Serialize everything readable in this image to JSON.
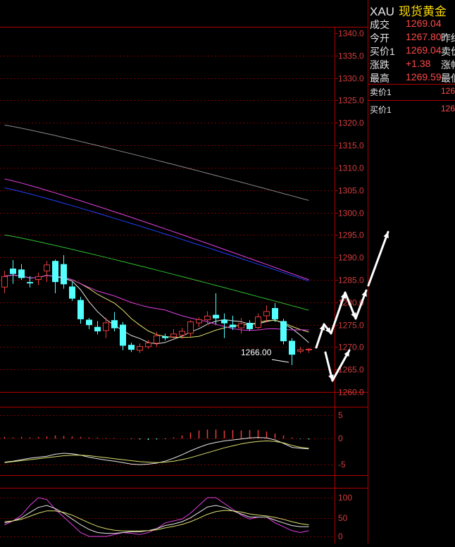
{
  "colors": {
    "background": "#000000",
    "frame": "#b00000",
    "grid": "#7a0000",
    "axis_text": "#d23c3c",
    "up_candle": "#e63c3c",
    "down_candle": "#54ffff",
    "ma_gray": "#8a8a8a",
    "ma_magenta": "#e040e0",
    "ma_blue": "#2040ff",
    "ma_green": "#30c030",
    "ma_yellow": "#e0e070",
    "ma_white": "#e6e6e6",
    "annotation_arrow": "#ffffff",
    "price_up": "#ff4a4a",
    "title_name": "#ffdd00"
  },
  "quote": {
    "code": "XAU",
    "name": "现货黄金",
    "rows": [
      {
        "label": "成交",
        "value": "1269.04",
        "label2": ""
      },
      {
        "label": "今开",
        "value": "1267.80",
        "label2": "昨结"
      },
      {
        "label": "买价1",
        "value": "1269.04",
        "label2": "卖价"
      },
      {
        "label": "涨跌",
        "value": "+1.38",
        "label2": "涨幅"
      },
      {
        "label": "最高",
        "value": "1269.59",
        "label2": "最低"
      }
    ]
  },
  "orderbook": {
    "ask": {
      "label": "卖价1",
      "value": "126"
    },
    "bid": {
      "label": "买价1",
      "value": "126"
    }
  },
  "chart_data": [
    {
      "type": "candlestick",
      "ylim": [
        1260.0,
        1340.0
      ],
      "y_ticks": [
        "1340.0",
        "1335.0",
        "1330.0",
        "1325.0",
        "1320.0",
        "1315.0",
        "1310.0",
        "1305.0",
        "1300.0",
        "1295.0",
        "1290.0",
        "1285.0",
        "1280.0",
        "1275.0",
        "1270.0",
        "1265.0",
        "1260.0"
      ],
      "grid": true,
      "annotation": "1266.00",
      "candles": [
        {
          "o": 1283.3,
          "h": 1287.0,
          "l": 1282.0,
          "c": 1285.8
        },
        {
          "o": 1287.5,
          "h": 1289.4,
          "l": 1284.1,
          "c": 1286.3
        },
        {
          "o": 1287.3,
          "h": 1288.5,
          "l": 1285.0,
          "c": 1285.4
        },
        {
          "o": 1284.5,
          "h": 1285.8,
          "l": 1283.3,
          "c": 1284.2
        },
        {
          "o": 1285.0,
          "h": 1286.6,
          "l": 1283.8,
          "c": 1285.8
        },
        {
          "o": 1286.9,
          "h": 1289.2,
          "l": 1284.5,
          "c": 1288.4
        },
        {
          "o": 1289.2,
          "h": 1289.5,
          "l": 1282.0,
          "c": 1284.5
        },
        {
          "o": 1288.5,
          "h": 1290.5,
          "l": 1283.0,
          "c": 1284.0
        },
        {
          "o": 1283.5,
          "h": 1284.5,
          "l": 1280.3,
          "c": 1280.8
        },
        {
          "o": 1280.5,
          "h": 1281.2,
          "l": 1275.2,
          "c": 1276.2
        },
        {
          "o": 1276.1,
          "h": 1276.5,
          "l": 1274.0,
          "c": 1274.9
        },
        {
          "o": 1274.5,
          "h": 1275.8,
          "l": 1272.8,
          "c": 1273.5
        },
        {
          "o": 1273.6,
          "h": 1276.5,
          "l": 1272.0,
          "c": 1275.5
        },
        {
          "o": 1276.0,
          "h": 1277.8,
          "l": 1273.5,
          "c": 1274.2
        },
        {
          "o": 1275.0,
          "h": 1275.6,
          "l": 1269.3,
          "c": 1270.3
        },
        {
          "o": 1270.5,
          "h": 1271.0,
          "l": 1268.9,
          "c": 1269.4
        },
        {
          "o": 1269.2,
          "h": 1270.8,
          "l": 1268.7,
          "c": 1270.2
        },
        {
          "o": 1270.0,
          "h": 1271.6,
          "l": 1269.6,
          "c": 1271.0
        },
        {
          "o": 1270.8,
          "h": 1273.4,
          "l": 1270.0,
          "c": 1272.6
        },
        {
          "o": 1272.4,
          "h": 1273.0,
          "l": 1271.5,
          "c": 1272.0
        },
        {
          "o": 1272.2,
          "h": 1274.0,
          "l": 1271.6,
          "c": 1273.0
        },
        {
          "o": 1272.6,
          "h": 1274.3,
          "l": 1271.8,
          "c": 1273.6
        },
        {
          "o": 1273.0,
          "h": 1276.0,
          "l": 1272.3,
          "c": 1275.7
        },
        {
          "o": 1275.3,
          "h": 1276.6,
          "l": 1274.5,
          "c": 1276.2
        },
        {
          "o": 1276.0,
          "h": 1278.0,
          "l": 1275.0,
          "c": 1277.0
        },
        {
          "o": 1277.2,
          "h": 1282.0,
          "l": 1275.0,
          "c": 1276.4
        },
        {
          "o": 1276.1,
          "h": 1277.5,
          "l": 1272.0,
          "c": 1275.3
        },
        {
          "o": 1275.0,
          "h": 1277.0,
          "l": 1273.8,
          "c": 1274.4
        },
        {
          "o": 1274.2,
          "h": 1276.5,
          "l": 1273.0,
          "c": 1275.3
        },
        {
          "o": 1275.4,
          "h": 1276.0,
          "l": 1273.6,
          "c": 1274.0
        },
        {
          "o": 1274.3,
          "h": 1277.5,
          "l": 1274.0,
          "c": 1276.8
        },
        {
          "o": 1276.9,
          "h": 1279.3,
          "l": 1275.5,
          "c": 1278.0
        },
        {
          "o": 1278.7,
          "h": 1279.8,
          "l": 1275.6,
          "c": 1276.2
        },
        {
          "o": 1275.8,
          "h": 1276.3,
          "l": 1270.6,
          "c": 1271.3
        },
        {
          "o": 1271.4,
          "h": 1272.0,
          "l": 1266.0,
          "c": 1268.3
        },
        {
          "o": 1269.0,
          "h": 1270.0,
          "l": 1268.6,
          "c": 1269.5
        },
        {
          "o": 1269.4,
          "h": 1269.8,
          "l": 1268.7,
          "c": 1269.6
        }
      ]
    },
    {
      "type": "bar",
      "y_ticks": [
        "5",
        "0",
        "-5"
      ]
    },
    {
      "type": "line",
      "y_ticks": [
        "100",
        "50",
        "0"
      ]
    }
  ]
}
